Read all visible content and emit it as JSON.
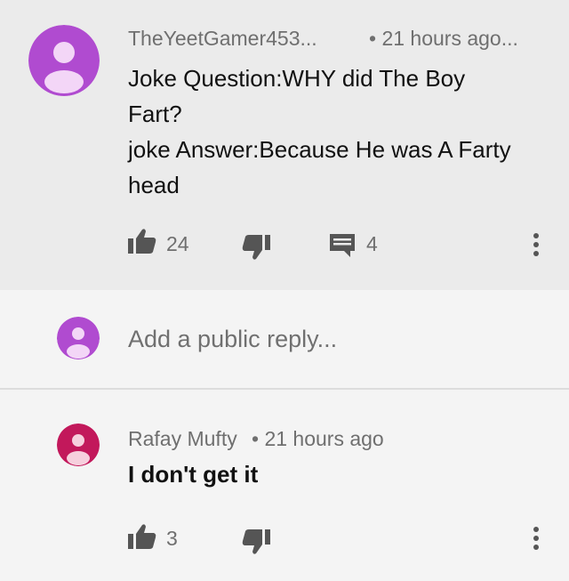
{
  "comment": {
    "author": "TheYeetGamer453...",
    "time": "• 21 hours ago...",
    "avatar_color": "#b04bd0",
    "body_lines": [
      "Joke Question:WHY did The Boy",
      "Fart?",
      "joke Answer:Because He was A Farty",
      "head"
    ],
    "likes": "24",
    "replies": "4"
  },
  "reply_box": {
    "placeholder": "Add a public reply...",
    "avatar_color": "#b04bd0"
  },
  "reply": {
    "author": "Rafay Mufty",
    "time": "• 21 hours ago",
    "avatar_color": "#c2185b",
    "body": "I don't get it",
    "likes": "3"
  },
  "colors": {
    "top_background": "#ebebeb",
    "page_background": "#f4f4f4",
    "meta_text": "#6f6f6f",
    "icon": "#555555"
  }
}
